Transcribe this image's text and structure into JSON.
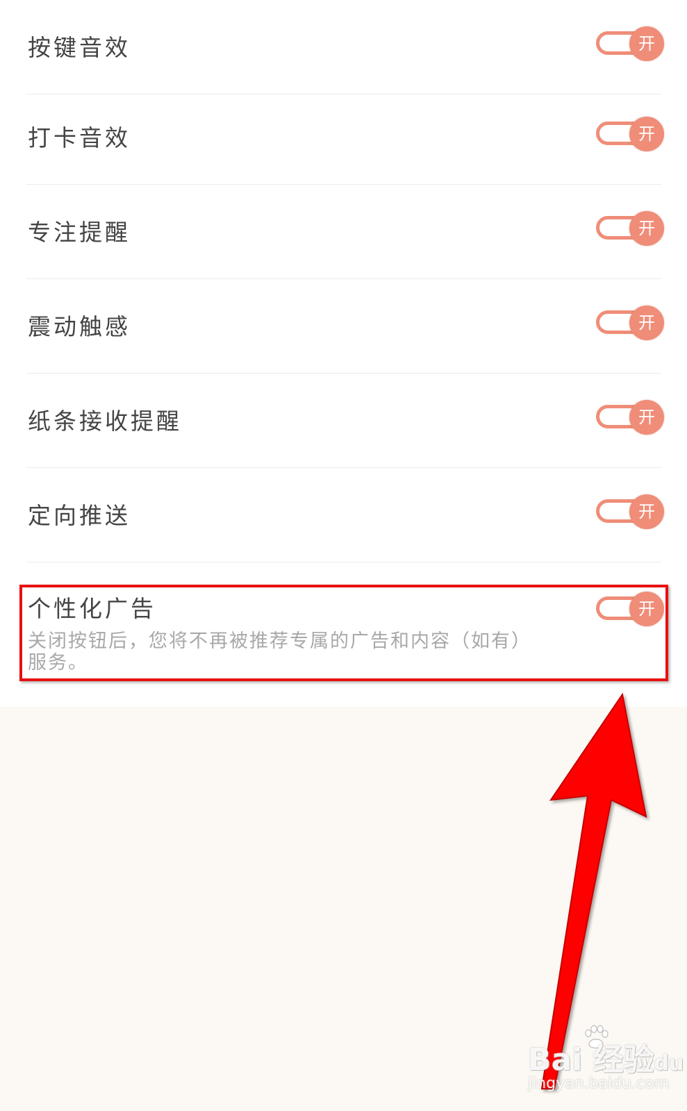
{
  "settings": {
    "items": [
      {
        "label": "按键音效",
        "toggle": "开"
      },
      {
        "label": "打卡音效",
        "toggle": "开"
      },
      {
        "label": "专注提醒",
        "toggle": "开"
      },
      {
        "label": "震动触感",
        "toggle": "开"
      },
      {
        "label": "纸条接收提醒",
        "toggle": "开"
      },
      {
        "label": "定向推送",
        "toggle": "开"
      }
    ],
    "ad": {
      "label": "个性化广告",
      "description": "关闭按钮后，您将不再被推荐专属的广告和内容（如有）服务。",
      "toggle": "开"
    }
  },
  "watermark": {
    "brand": "Bai 经验",
    "brand_du": "du",
    "url": "jingyan.baidu.com"
  },
  "colors": {
    "toggle_accent": "#ef8d78",
    "highlight": "#e81010",
    "arrow": "#ff0000",
    "page_bg": "#fcf8f3"
  },
  "icons": {
    "watermark": "paw-icon",
    "annotation": "arrow-icon"
  }
}
